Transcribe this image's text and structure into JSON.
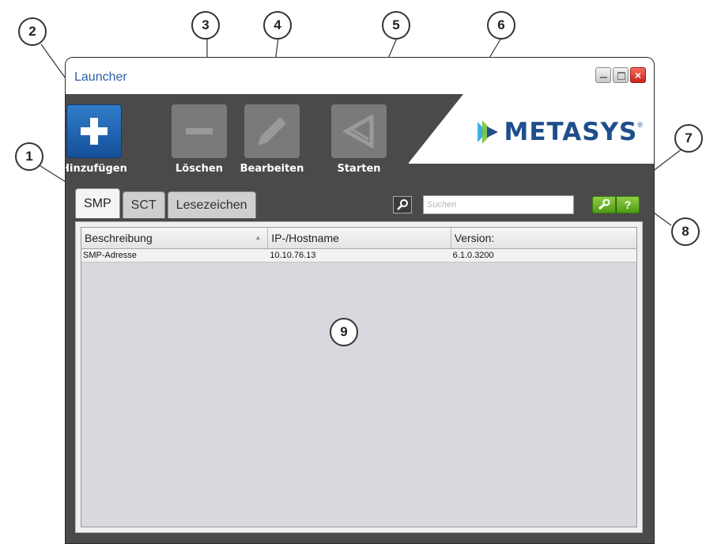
{
  "window": {
    "title": "Launcher",
    "controls": {
      "minimize": "minimize-icon",
      "maximize": "maximize-icon",
      "close": "×"
    }
  },
  "toolbar": {
    "add_label": "Hinzufügen",
    "delete_label": "Löschen",
    "edit_label": "Bearbeiten",
    "start_label": "Starten"
  },
  "logo": {
    "text": "METASYS",
    "tm": "®"
  },
  "tabs": [
    {
      "label": "SMP",
      "active": true
    },
    {
      "label": "SCT",
      "active": false
    },
    {
      "label": "Lesezeichen",
      "active": false
    }
  ],
  "search": {
    "placeholder": "Suchen",
    "value": ""
  },
  "help": {
    "settings_icon": "wrench-icon",
    "help_label": "?"
  },
  "table": {
    "columns": [
      "Beschreibung",
      "IP-/Hostname",
      "Version:"
    ],
    "rows": [
      [
        "SMP-Adresse",
        "10.10.76.13",
        "6.1.0.3200"
      ]
    ]
  },
  "callouts": [
    "1",
    "2",
    "3",
    "4",
    "5",
    "6",
    "7",
    "8",
    "9"
  ],
  "colors": {
    "accent": "#2f7cc8",
    "frame": "#4a4a4a",
    "title": "#2d5fa8",
    "logo": "#1f4e8c",
    "help_green": "#6db52a"
  }
}
